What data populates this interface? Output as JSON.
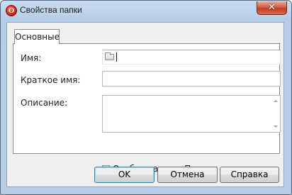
{
  "window": {
    "title": "Свойства папки",
    "close_label": "✕"
  },
  "tabs": [
    {
      "label": "Основные",
      "selected": true
    }
  ],
  "form": {
    "name_label": "Имя:",
    "name_value": "",
    "short_name_label": "Краткое имя:",
    "short_name_value": "",
    "description_label": "Описание:",
    "description_value": "",
    "show_on_bookmarks_bar_label": "Отображать на Панели закладок",
    "show_on_bookmarks_bar_checked": false
  },
  "buttons": {
    "ok": "OK",
    "cancel": "Отмена",
    "help": "Справка"
  },
  "colors": {
    "title_bar": "#b9cde6",
    "close_button": "#c33d22",
    "default_button_border": "#3c7fb1"
  }
}
